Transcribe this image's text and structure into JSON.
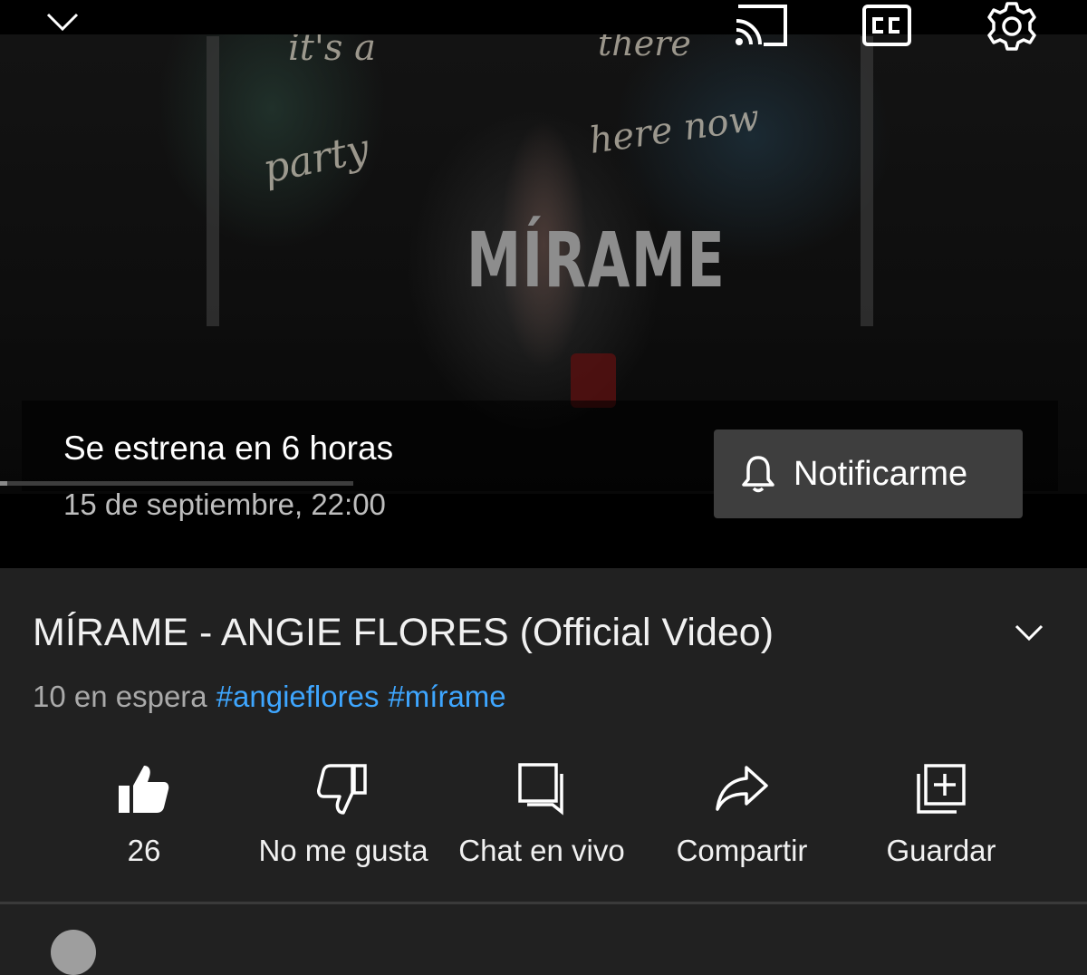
{
  "player": {
    "thumbnail_title": "MÍRAME",
    "neon_text_top": "it's a",
    "neon_text_there": "there",
    "neon_text_party": "party",
    "neon_text_here": "here now",
    "premiere_title": "Se estrena en 6 horas",
    "premiere_date": "15 de septiembre, 22:00",
    "notify_label": "Notificarme",
    "progress_fraction": 0.02,
    "icons": [
      "chevron-down-icon",
      "cast-icon",
      "captions-icon",
      "settings-gear-icon",
      "bell-icon"
    ]
  },
  "video": {
    "title": "MÍRAME - ANGIE FLORES (Official Video)",
    "waiting": "10 en espera",
    "hashtags": [
      "#angieflores",
      "#mírame"
    ]
  },
  "actions": [
    {
      "label": "26",
      "icon": "thumbs-up-filled-icon"
    },
    {
      "label": "No me gusta",
      "icon": "thumbs-down-icon"
    },
    {
      "label": "Chat en vivo",
      "icon": "live-chat-icon"
    },
    {
      "label": "Compartir",
      "icon": "share-icon"
    },
    {
      "label": "Guardar",
      "icon": "save-playlist-icon"
    }
  ],
  "colors": {
    "background": "#212121",
    "hashtag": "#3ea6ff",
    "notify_button": "#3e3e3e"
  }
}
